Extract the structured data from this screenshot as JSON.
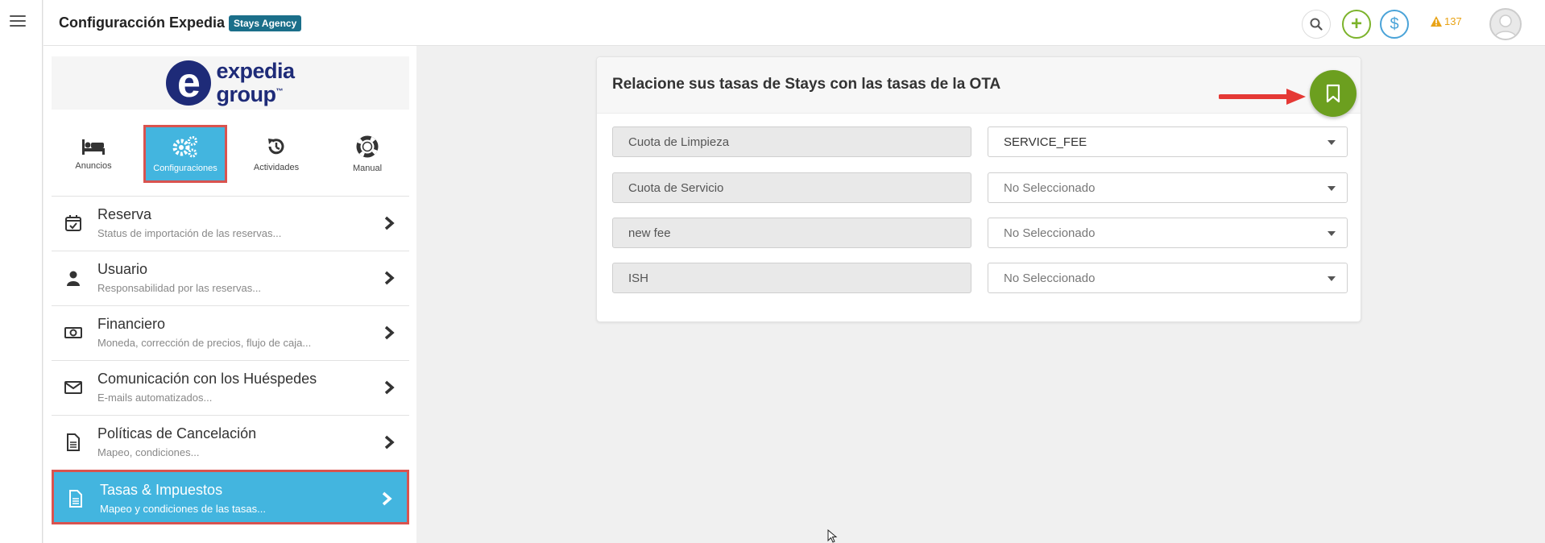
{
  "app": {
    "title": "Configuracción Expedia",
    "badge": "Stays Agency",
    "alert_count": "137"
  },
  "colors": {
    "accent_blue": "#43b5df",
    "highlight_red": "#d9534f",
    "save_green": "#6c9f1f",
    "badge_bg": "#1b6f8a"
  },
  "logo": {
    "line1": "expedia",
    "line2": "group"
  },
  "tiles": [
    {
      "label": "Anuncios",
      "icon": "bed-icon"
    },
    {
      "label": "Configuraciones",
      "icon": "gears-icon"
    },
    {
      "label": "Actividades",
      "icon": "history-icon"
    },
    {
      "label": "Manual",
      "icon": "lifebuoy-icon"
    }
  ],
  "nav": [
    {
      "title": "Reserva",
      "subtitle": "Status de importación de las reservas...",
      "icon": "calendar-check-icon"
    },
    {
      "title": "Usuario",
      "subtitle": "Responsabilidad por las reservas...",
      "icon": "user-icon"
    },
    {
      "title": "Financiero",
      "subtitle": "Moneda, corrección de precios, flujo de caja...",
      "icon": "money-icon"
    },
    {
      "title": "Comunicación con los Huéspedes",
      "subtitle": "E-mails automatizados...",
      "icon": "envelope-icon"
    },
    {
      "title": "Políticas de Cancelación",
      "subtitle": "Mapeo, condiciones...",
      "icon": "document-icon"
    },
    {
      "title": "Tasas & Impuestos",
      "subtitle": "Mapeo y condiciones de las tasas...",
      "icon": "document-icon"
    }
  ],
  "card": {
    "title": "Relacione sus tasas de Stays con las tasas de la OTA",
    "rows": [
      {
        "fee": "Cuota de Limpieza",
        "mapped": "SERVICE_FEE"
      },
      {
        "fee": "Cuota de Servicio",
        "mapped": "No Seleccionado"
      },
      {
        "fee": "new fee",
        "mapped": "No Seleccionado"
      },
      {
        "fee": "ISH",
        "mapped": "No Seleccionado"
      }
    ]
  }
}
